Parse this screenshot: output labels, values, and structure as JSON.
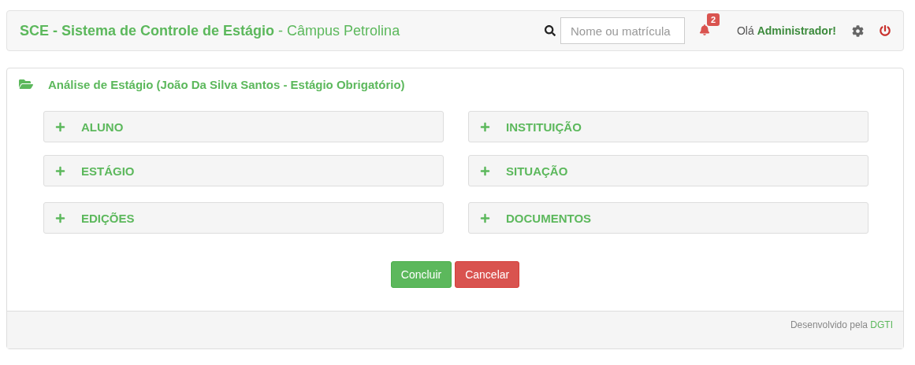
{
  "navbar": {
    "title": "**SCE - Sistema de Controle de Estágio** - Câmpus Petrolina",
    "search": {
      "placeholder": "Nome ou matrícula"
    },
    "notifications": {
      "count": "2"
    },
    "greeting": "Olá **Administrador!**"
  },
  "panel": {
    "title": "Análise de Estágio (João Da Silva Santos - Estágio Obrigatório)",
    "sections": [
      {
        "label": "ALUNO",
        "expanded": false
      },
      {
        "label": "INSTITUIÇÃO",
        "expanded": false
      },
      {
        "label": "ESTÁGIO",
        "expanded": false
      },
      {
        "label": "SITUAÇÃO",
        "expanded": false
      },
      {
        "label": "EDIÇÕES",
        "expanded": false
      },
      {
        "label": "DOCUMENTOS",
        "expanded": false
      }
    ],
    "buttons": [
      {
        "label": "Concluir",
        "kind": "success"
      },
      {
        "label": "Cancelar",
        "kind": "danger"
      }
    ],
    "footer": {
      "text": "Desenvolvido pela",
      "link": "DGTI"
    }
  }
}
